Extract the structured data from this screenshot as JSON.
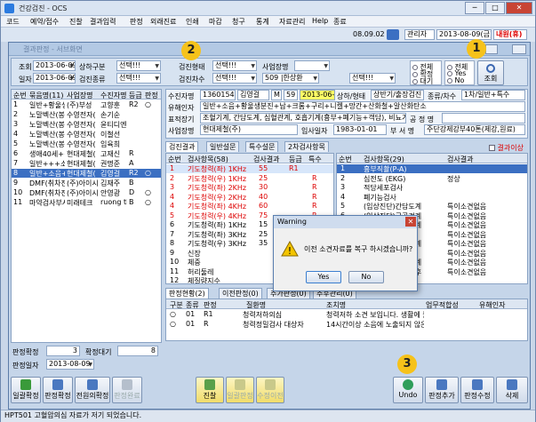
{
  "window": {
    "title": "건강검진 - OCS"
  },
  "menu": [
    "코드",
    "예약/접수",
    "진찰",
    "결과입력",
    "판정",
    "외래진료",
    "인쇄",
    "마감",
    "청구",
    "통계",
    "자료관리",
    "Help",
    "종료"
  ],
  "toolbar": {
    "version": "08.09.02",
    "user_label": "관리자",
    "date": "2013-08-09(금)",
    "status_tag": "내원(휴)"
  },
  "inner_title": "결과판정 - 서브화면",
  "filters": {
    "row1": {
      "label_date": "조회",
      "date": "2013-06-09",
      "label_type": "상하구분",
      "type_value": "선택!!!",
      "label_status": "검진형태",
      "status_value": "선택!!!",
      "label_biz": "사업장명",
      "biz_value": ""
    },
    "row2": {
      "label_date": "일자",
      "date": "2013-06-09",
      "label_kind": "검진종류",
      "kind_value": "선택!!!",
      "label_sub": "검진차수",
      "sub_value": "선택!!!",
      "doctor_value": "509 |한상환",
      "doctor2_value": "선택!!!"
    },
    "radio1": [
      "전체",
      "확정",
      "대기"
    ],
    "radio2": [
      "전체",
      "Yes",
      "No"
    ],
    "search_button": "조회"
  },
  "left_list": {
    "headers": [
      "순번",
      "묶음명(11)",
      "사업장명",
      "수진자명",
      "등급",
      "판정"
    ],
    "rows": [
      [
        "1",
        "일반+황울생",
        "(주)부성",
        "고향훈",
        "R2",
        "○"
      ],
      [
        "2",
        "노말벡산(봉",
        "수영전자(",
        "손기순",
        "",
        ""
      ],
      [
        "3",
        "노말벡산(봉",
        "수영전자(",
        "윤티디엔",
        "",
        ""
      ],
      [
        "4",
        "노말벡산(봉",
        "수영전자(",
        "이철선",
        "",
        ""
      ],
      [
        "5",
        "노말벡산(봉",
        "수영전자(",
        "임육희",
        "",
        ""
      ],
      [
        "6",
        "생애40세+++",
        "현대제철(",
        "고재신",
        "R",
        ""
      ],
      [
        "7",
        "일반+++소음",
        "현대제철(",
        "권명준",
        "A",
        ""
      ],
      [
        "8",
        "일반+소음+",
        "현대제철(",
        "김영걸",
        "R2",
        "○"
      ],
      [
        "9",
        "DMF(취차전:",
        "(주)아이시",
        "김재주",
        "B",
        ""
      ],
      [
        "10",
        "DMF(취차전:",
        "(주)아이시",
        "안영광",
        "D",
        "○"
      ],
      [
        "11",
        "마약검사부서",
        "미래테크",
        "ruong th",
        "B",
        "○"
      ]
    ],
    "footer": {
      "label_done": "판정확정",
      "done_value": "3",
      "label_wait": "확정대기",
      "wait_value": "8",
      "label_date": "판정일자",
      "date_value": "2013-08-09"
    }
  },
  "patient": {
    "l_name": "수진자명",
    "chart": "13601549",
    "name": "김영걸",
    "sex": "M",
    "age": "59",
    "visit_date": "2013-06-10",
    "l_category": "상하/형태",
    "category": "상반기/출장검진",
    "l_kind": "종류/차수",
    "kind": "1차/일반+특수",
    "l_harmful": "유해인자",
    "harmful": "일반+소음+황울생분진+납+크롬+구리+니켈+망간+산화철+알산화탄소",
    "l_target": "표적장기",
    "target": "조혈기계, 간담도계, 심혈관계, 호흡기계(흉부+폐기능+객담), 비뇨기계",
    "l_occ": "공 정 명",
    "occ": "",
    "l_biz": "사업장명",
    "biz": "현대제철(주)",
    "l_join": "입사일자",
    "join": "1983-01-01",
    "l_dept": "부 서 명",
    "dept": "주단강제강부40톤(제강,원료)"
  },
  "tabs": [
    "검진결과",
    "일반설문",
    "특수설문",
    "2차검사항목"
  ],
  "result_abnormal": "결과이상",
  "results": {
    "headers": [
      "순번",
      "검사항목(58)",
      "검사결과",
      "등급",
      "특수"
    ],
    "rows": [
      [
        "1",
        "기도청력(좌) 1KHz",
        "55",
        "R1",
        ""
      ],
      [
        "2",
        "기도청력(우) 1KHz",
        "25",
        "",
        "R"
      ],
      [
        "3",
        "기도청력(좌) 2KHz",
        "30",
        "",
        "R"
      ],
      [
        "4",
        "기도청력(우) 2KHz",
        "40",
        "",
        "R"
      ],
      [
        "4",
        "기도청력(좌) 4KHz",
        "60",
        "",
        "R"
      ],
      [
        "5",
        "기도청력(우) 4KHz",
        "75",
        "",
        "R"
      ],
      [
        "6",
        "기도청력(좌) 1KHz",
        "15",
        "",
        "R"
      ],
      [
        "7",
        "기도청력(좌) 3KHz",
        "25",
        "",
        "R"
      ],
      [
        "8",
        "기도청력(우) 3KHz",
        "35",
        "",
        "R"
      ],
      [
        "9",
        "신장",
        "",
        "",
        ""
      ],
      [
        "10",
        "체중",
        "",
        "",
        ""
      ],
      [
        "11",
        "허리둘레",
        "",
        "",
        ""
      ],
      [
        "12",
        "체질량지수",
        "",
        "",
        ""
      ]
    ]
  },
  "exams": {
    "headers": [
      "순번",
      "검사항목(29)",
      "검사결과"
    ],
    "rows": [
      [
        "1",
        "흉부직촬(P-A)",
        ""
      ],
      [
        "2",
        "심전도 (EKG)",
        "정상"
      ],
      [
        "3",
        "적당세포검사",
        ""
      ],
      [
        "4",
        "폐기능검사",
        ""
      ],
      [
        "5",
        "(임상진단)간담도계",
        "특이소견없음"
      ],
      [
        "6",
        "(임상진단)근골격계",
        "특이소견없음"
      ],
      [
        "7",
        "(임상진단)비뇨기계",
        "특이소견없음"
      ],
      [
        "8",
        "(임상진단)신경계",
        "특이소견없음"
      ],
      [
        "9",
        "(임상진단)심혈관계",
        "특이소견없음"
      ],
      [
        "10",
        "(임상진단)피부",
        "특이소견없음"
      ],
      [
        "11",
        "(임상진단)호흡기계",
        "특이소견없음"
      ],
      [
        "12",
        "(임상진단)이비인후",
        "특이소견없음"
      ]
    ]
  },
  "bottom_tabs": [
    "판정현황(2)",
    "이전판정(0)",
    "추가판정(0)",
    "추후관리(0)"
  ],
  "judgments": {
    "headers": [
      "구분",
      "종류",
      "판정",
      "질환명",
      "조치명",
      "업무적합성",
      "유해인자"
    ],
    "rows": [
      [
        "○",
        "01",
        "R1",
        "청력저하의심",
        "청력저하 소견 보입니다. 생활에 불편시 이비인후과 진료",
        "",
        ""
      ],
      [
        "○",
        "01",
        "R",
        "청력정밀검사 대상자",
        "14시간이상 소음에 노출되지 않은 상태에서 소음",
        "",
        ""
      ]
    ]
  },
  "dialog": {
    "title": "Warning",
    "message": "이전 소견자료를 복구 하시겠습니까?",
    "yes": "Yes",
    "no": "No"
  },
  "bottom_buttons": {
    "batch": "일괄확정",
    "confirm": "판정확정",
    "cancel": "전원의확정",
    "release": "판정완료",
    "exam": "진찰",
    "result": "일괄판정",
    "prev": "수정이전",
    "undo": "Undo",
    "add": "판정추가",
    "edit": "판정수정",
    "delete": "삭제"
  },
  "status": "HPT501 고혈압의심 자료가 저기 되었습니다.",
  "badges": [
    "1",
    "2",
    "3"
  ]
}
